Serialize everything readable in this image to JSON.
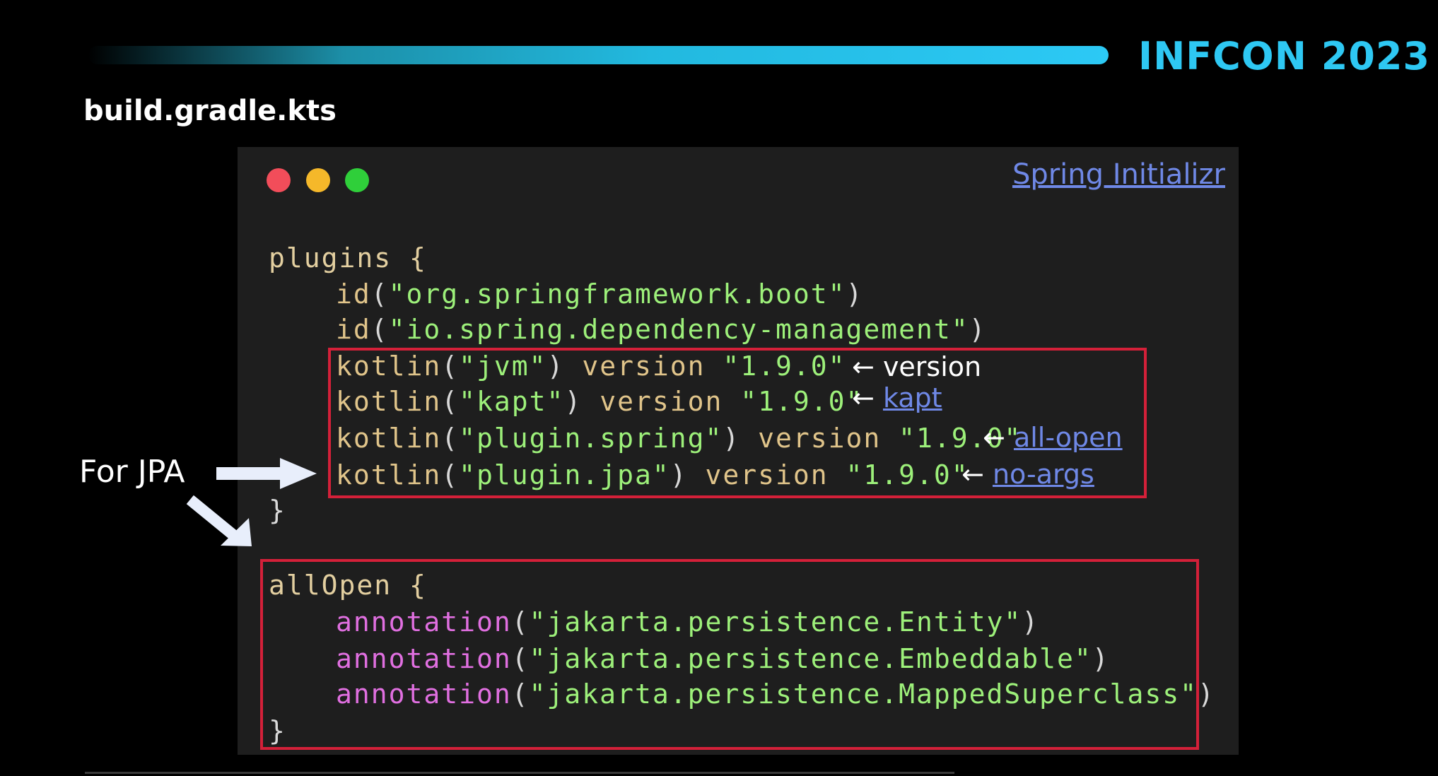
{
  "slide": {
    "brand": "INFCON 2023",
    "file_title": "build.gradle.kts",
    "initializr_link": "Spring Initializr",
    "for_jpa_label": "For JPA"
  },
  "code": {
    "plugins_open": "plugins {",
    "id1_fn": "id",
    "id1_str": "\"org.springframework.boot\"",
    "id2_fn": "id",
    "id2_str": "\"io.spring.dependency-management\"",
    "k1_fn": "kotlin",
    "k1_arg": "\"jvm\"",
    "k1_version_kw": "version",
    "k1_version": "\"1.9.0\"",
    "k2_fn": "kotlin",
    "k2_arg": "\"kapt\"",
    "k2_version_kw": "version",
    "k2_version": "\"1.9.0\"",
    "k3_fn": "kotlin",
    "k3_arg": "\"plugin.spring\"",
    "k3_version_kw": "version",
    "k3_version": "\"1.9.0\"",
    "k4_fn": "kotlin",
    "k4_arg": "\"plugin.jpa\"",
    "k4_version_kw": "version",
    "k4_version": "\"1.9.0\"",
    "close_brace": "}",
    "allopen_open": "allOpen {",
    "ann_fn": "annotation",
    "ann1_str": "\"jakarta.persistence.Entity\"",
    "ann2_str": "\"jakarta.persistence.Embeddable\"",
    "ann3_str": "\"jakarta.persistence.MappedSuperclass\"",
    "allopen_close": "}"
  },
  "notes": {
    "arrow": "←",
    "version": "version",
    "kapt": "kapt",
    "all_open": "all-open",
    "no_args": "no-args"
  },
  "colors": {
    "brand": "#2ec8f3",
    "highlight_border": "#d42039",
    "link": "#6f88e6",
    "string": "#9df07a",
    "annotation": "#e06fe0"
  }
}
